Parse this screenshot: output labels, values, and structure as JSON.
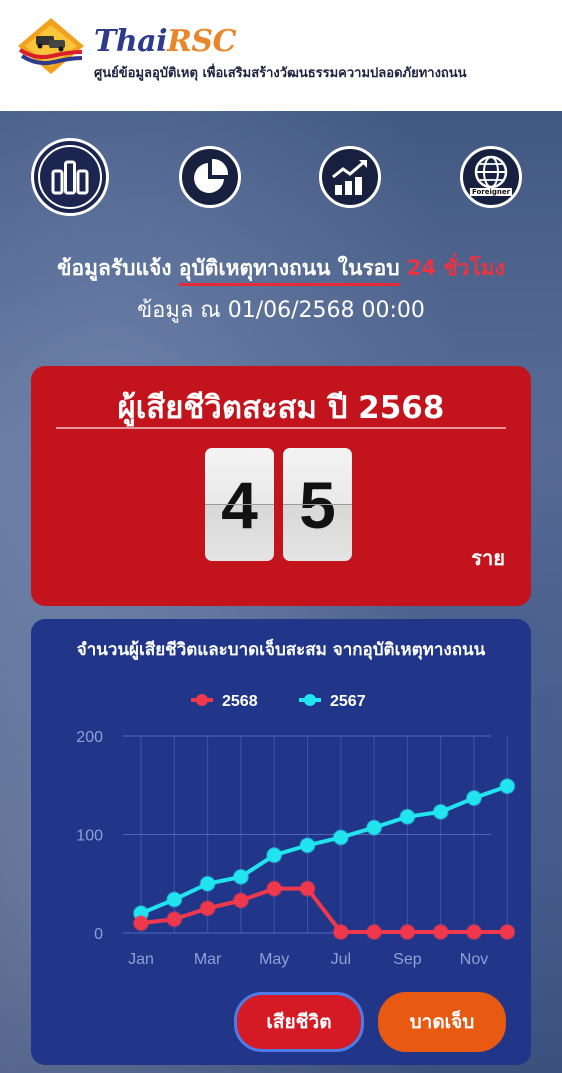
{
  "header": {
    "logo_title_1": "Thai",
    "logo_title_2": "RSC",
    "logo_subtitle": "ศูนย์ข้อมูลอุบัติเหตุ เพื่อเสริมสร้างวัฒนธรรมความปลอดภัยทางถนน"
  },
  "nav": {
    "items": [
      {
        "icon": "bar-chart-icon",
        "active": true
      },
      {
        "icon": "pie-chart-icon",
        "active": false
      },
      {
        "icon": "growth-chart-icon",
        "active": false
      },
      {
        "icon": "globe-icon",
        "active": false,
        "label": "Foreigner"
      }
    ]
  },
  "info": {
    "prefix": "ข้อมูลรับแจ้ง",
    "highlight": "อุบัติเหตุทางถนน ในรอบ",
    "suffix": "24 ชั่วโมง",
    "timestamp": "ข้อมูล ณ 01/06/2568 00:00"
  },
  "death_card": {
    "title": "ผู้เสียชีวิตสะสม ปี 2568",
    "digit_1": "4",
    "digit_2": "5",
    "unit": "ราย"
  },
  "chart_card": {
    "title": "จำนวนผู้เสียชีวิตและบาดเจ็บสะสม จากอุบัติเหตุทางถนน",
    "button_death": "เสียชีวิต",
    "button_injury": "บาดเจ็บ"
  },
  "colors": {
    "red_card": "#c3141e",
    "chart_card": "#213689",
    "series_2568": "#f0384d",
    "series_2567": "#22e4ee"
  },
  "chart_data": {
    "type": "line",
    "x": [
      "Jan",
      "Feb",
      "Mar",
      "Apr",
      "May",
      "Jun",
      "Jul",
      "Aug",
      "Sep",
      "Oct",
      "Nov",
      "Dec"
    ],
    "x_tick_labels": [
      "Jan",
      "Mar",
      "May",
      "Jul",
      "Sep",
      "Nov"
    ],
    "ylim": [
      0,
      200
    ],
    "y_ticks": [
      0,
      100,
      200
    ],
    "grid": true,
    "legend_position": "top",
    "series": [
      {
        "name": "2568",
        "values": [
          10,
          14,
          25,
          33,
          45,
          45,
          1,
          1,
          1,
          1,
          1,
          1
        ]
      },
      {
        "name": "2567",
        "values": [
          20,
          34,
          50,
          57,
          79,
          89,
          97,
          107,
          118,
          123,
          137,
          149
        ]
      }
    ]
  }
}
